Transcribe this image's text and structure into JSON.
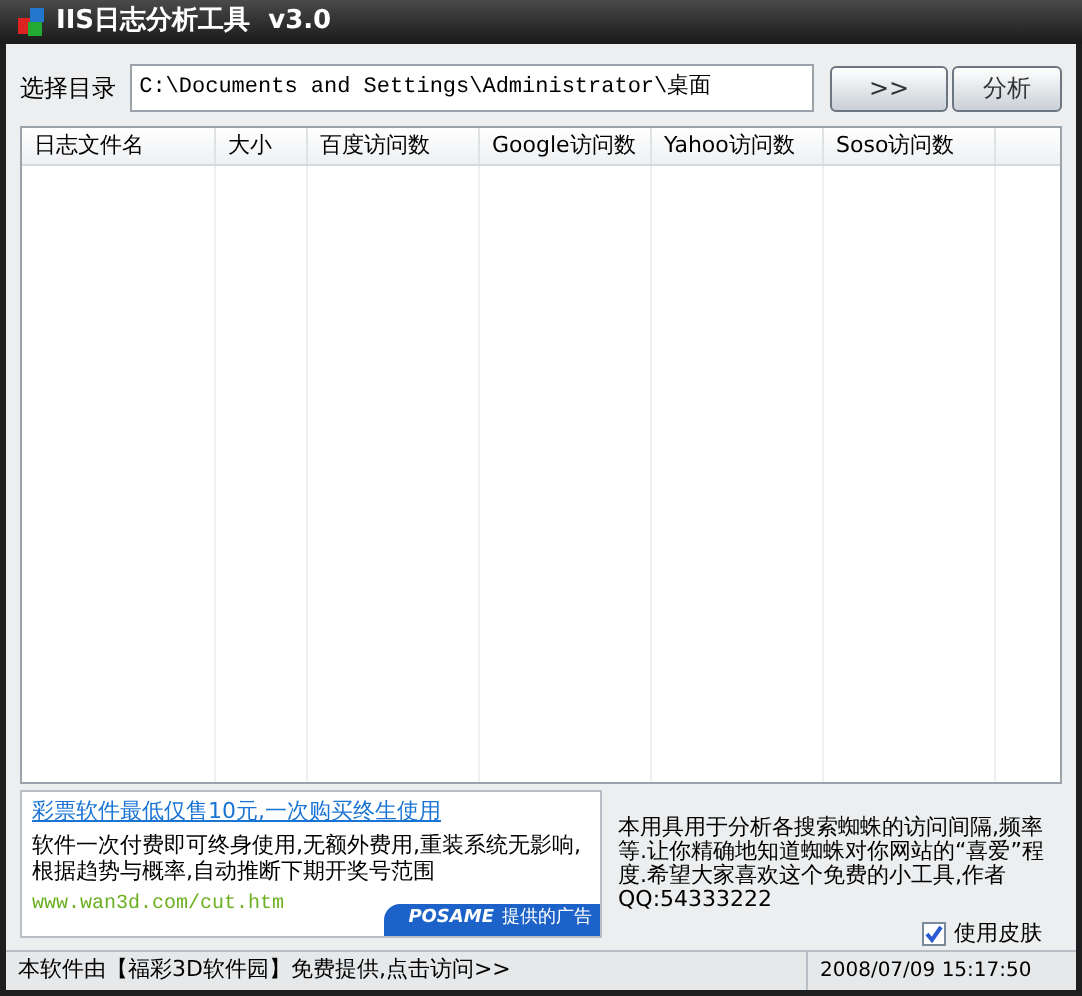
{
  "window": {
    "title": "IIS日志分析工具  v3.0"
  },
  "directory": {
    "label": "选择目录",
    "value": "C:\\Documents and Settings\\Administrator\\桌面"
  },
  "buttons": [
    {
      "label": ">>"
    },
    {
      "label": "分析"
    }
  ],
  "table": {
    "columns": [
      "日志文件名",
      "大小",
      "百度访问数",
      "Google访问数",
      "Yahoo访问数",
      "Soso访问数"
    ]
  },
  "ad": {
    "headline": "彩票软件最低仅售10元,一次购买终生使用",
    "body": "软件一次付费即可终身使用,无额外费用,重装系统无影响,根据趋势与概率,自动推断下期开奖号范围",
    "url": "www.wan3d.com/cut.htm",
    "brand": "POSAME",
    "badge": "提供的广告"
  },
  "description": "本用具用于分析各搜索蜘蛛的访问间隔,频率等.让你精确地知道蜘蛛对你网站的“喜爱”程度.希望大家喜欢这个免费的小工具,作者QQ:54333222",
  "skin_checkbox": {
    "label": "使用皮肤",
    "checked": true
  },
  "status_bar": {
    "message": "本软件由【福彩3D软件园】免费提供,点击访问>>",
    "datetime": "2008/07/09 15:17:50"
  }
}
